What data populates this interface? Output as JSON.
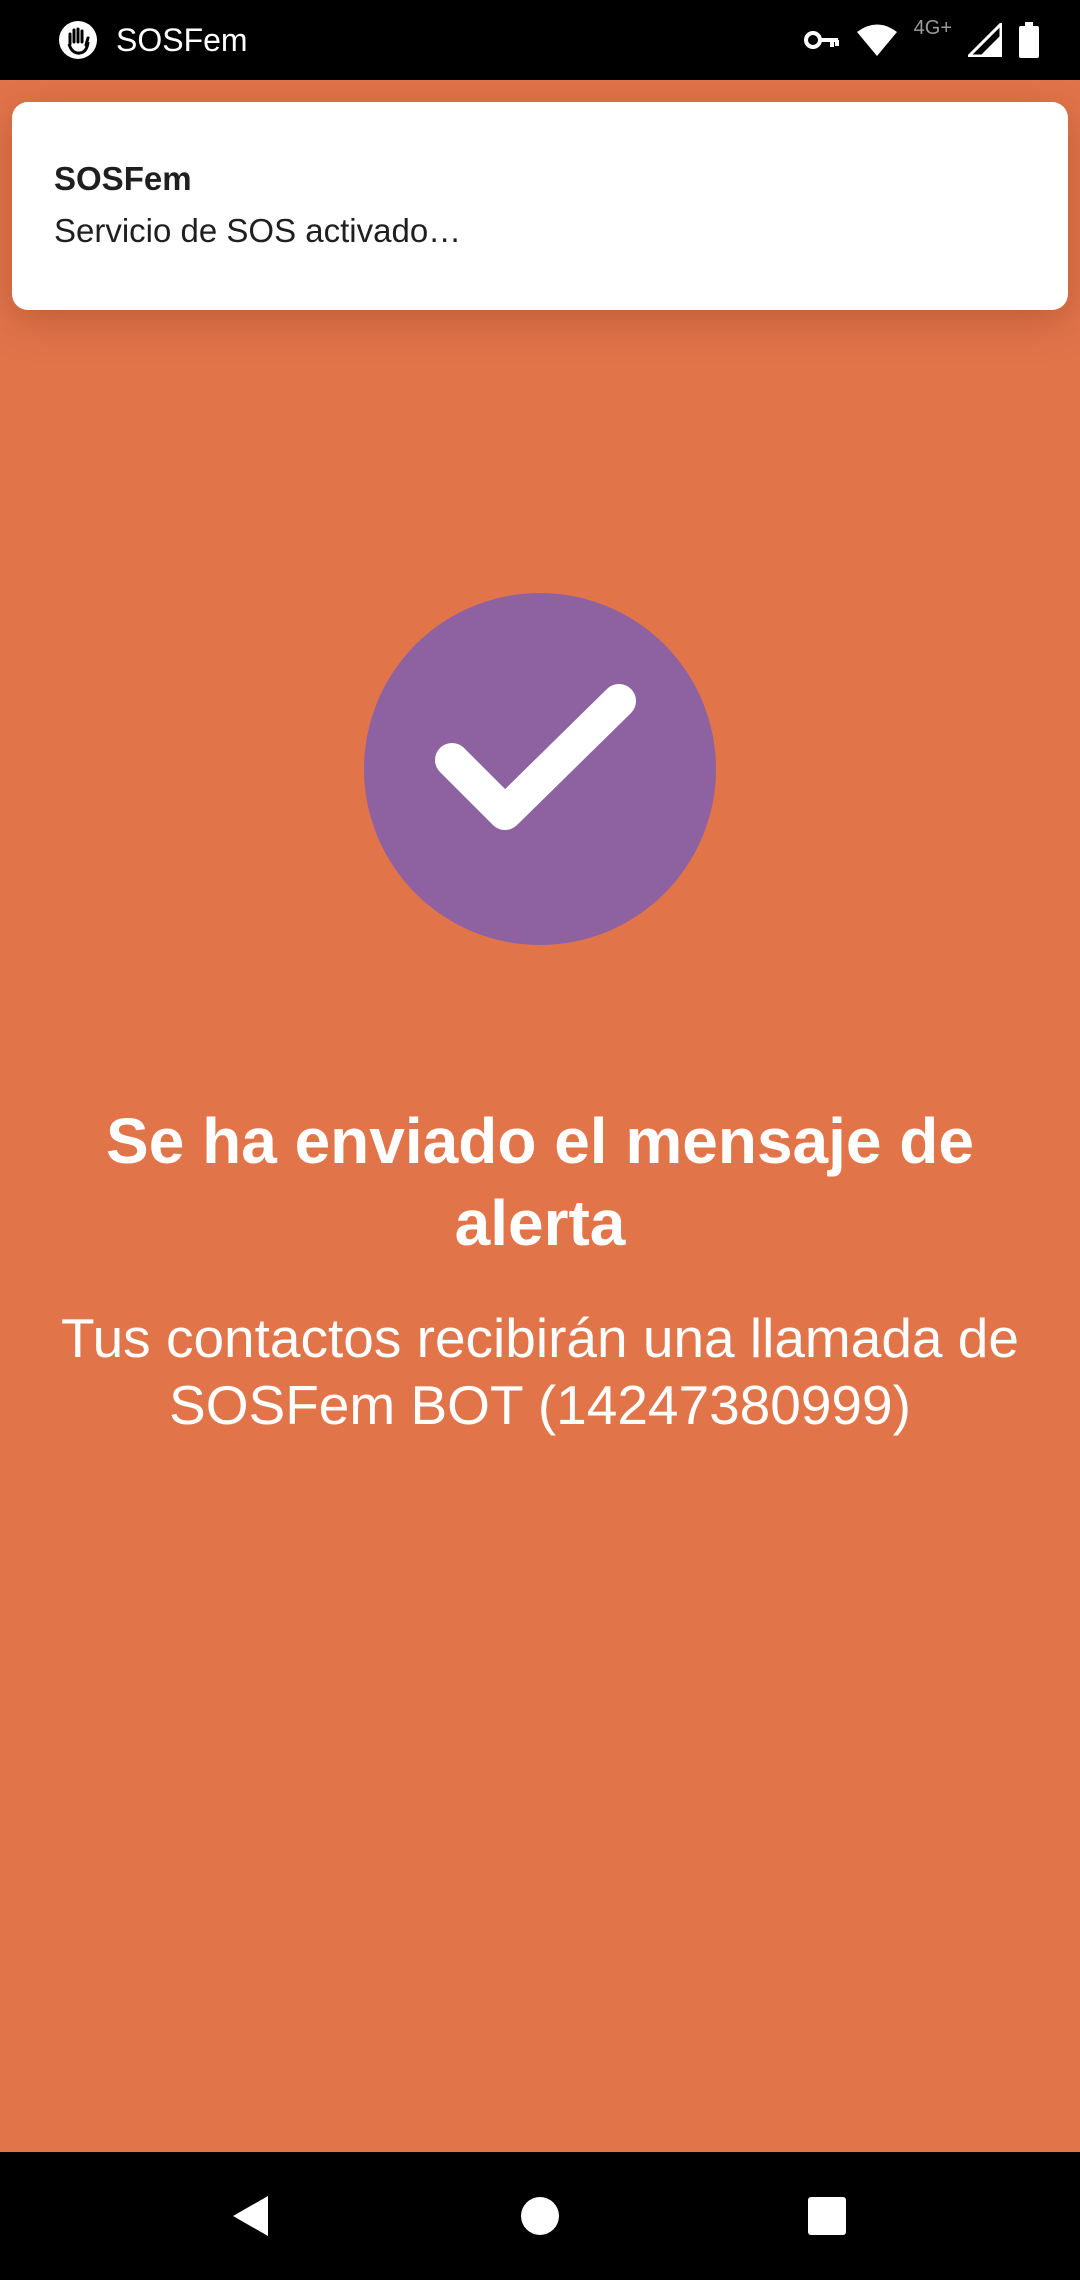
{
  "status_bar": {
    "app_name": "SOSFem",
    "app_icon": "hand-icon",
    "network_label": "4G+",
    "icons": [
      "key-icon",
      "wifi-icon",
      "signal-icon",
      "battery-icon"
    ]
  },
  "notification": {
    "title": "SOSFem",
    "text": "Servicio de SOS activado…"
  },
  "main": {
    "status_icon": "checkmark-icon",
    "headline": "Se ha enviado el mensaje de alerta",
    "subline": "Tus contactos recibirán una llamada de SOSFem BOT (14247380999)"
  },
  "nav_bar": {
    "buttons": [
      "back-icon",
      "home-icon",
      "recents-icon"
    ]
  },
  "colors": {
    "background": "#E2744A",
    "circle": "#8E62A1",
    "notification": "#FFFFFF",
    "text": "#FFFFFF"
  }
}
